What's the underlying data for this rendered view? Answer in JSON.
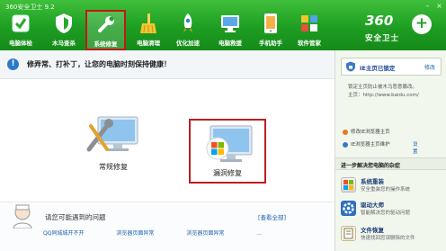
{
  "window": {
    "title": "360安全卫士 9.2",
    "minimize": "–",
    "close": "×"
  },
  "nav": [
    {
      "label": "电脑体检"
    },
    {
      "label": "木马查杀"
    },
    {
      "label": "系统修复"
    },
    {
      "label": "电脑清理"
    },
    {
      "label": "优化加速"
    },
    {
      "label": "电脑救援"
    },
    {
      "label": "手机助手"
    },
    {
      "label": "软件管家"
    }
  ],
  "brand": {
    "number": "360",
    "plus": "+",
    "name": "安全卫士"
  },
  "banner": {
    "icon": "!",
    "text": "修弄常、打补丁，让您的电脑时刻保持健康！"
  },
  "cards": [
    {
      "label": "常规修复"
    },
    {
      "label": "漏洞修复"
    }
  ],
  "problems": {
    "title": "请您可能遇到的问题",
    "view_all": "[查看全部]",
    "links": [
      "QQ同城城开不开",
      "浏览器页面异常",
      "浏览器页面异常",
      "..."
    ]
  },
  "side": {
    "lock": {
      "title": "IE主页已锁定",
      "modify": "修改"
    },
    "desc": [
      "锁定主页防止被木马恶意篡改。",
      "主页：http://www.baidu.com/"
    ],
    "rows": [
      {
        "text": "修改IE浏览器主页"
      },
      {
        "text": "IE浏览器主页维护",
        "action": "设置"
      }
    ],
    "section": "进一步解决您电脑的杂症",
    "entries": [
      {
        "name": "系统重装",
        "desc": "安全重装您的操作系统"
      },
      {
        "name": "驱动大师",
        "desc": "智能解决您的驱动问题"
      },
      {
        "name": "文件恢复",
        "desc": "快速找回您误删除的文件"
      }
    ]
  },
  "colors": {
    "header": "#1e9e22",
    "highlight": "#b82020",
    "link": "#1b5fae"
  }
}
